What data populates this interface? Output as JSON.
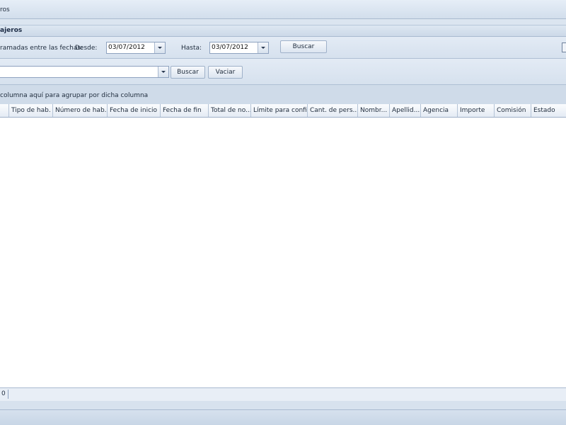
{
  "window": {
    "title_fragment": "ros"
  },
  "panel": {
    "title": "ajeros"
  },
  "filter": {
    "range_label": "ramadas entre las fechas:",
    "from_label": "Desde:",
    "from_value": "03/07/2012",
    "to_label": "Hasta:",
    "to_value": "03/07/2012",
    "search_button": "Buscar"
  },
  "search": {
    "value": "",
    "search_button": "Buscar",
    "clear_button": "Vaciar"
  },
  "group_panel": {
    "hint": "columna aquí para agrupar por dicha columna"
  },
  "grid": {
    "columns": [
      "Tipo de hab.",
      "Número de hab.",
      "Fecha de inicio",
      "Fecha de fin",
      "Total de no...",
      "Límite para confi...",
      "Cant. de pers...",
      "Nombr...",
      "Apellid...",
      "Agencia",
      "Importe",
      "Comisión",
      "Estado"
    ]
  },
  "footer": {
    "count": "0"
  }
}
